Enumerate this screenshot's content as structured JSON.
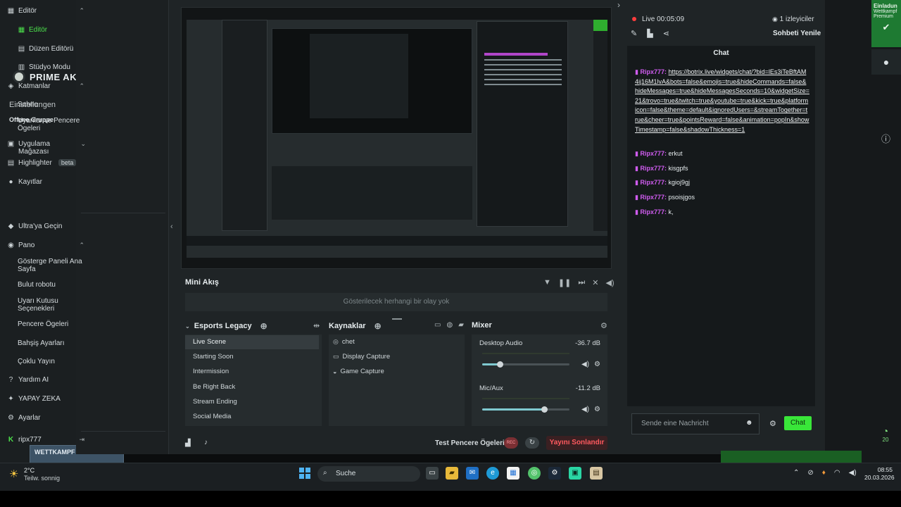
{
  "background": {
    "brand": "PRIME AKTI",
    "einstellungen": "Einstellungen",
    "offene_gruppe": "Offene Gruppe",
    "thumb_label": "WETTKAMPF"
  },
  "sidebar": {
    "editor_group": "Editör",
    "editor": "Editör",
    "layout_editor": "Düzen Editörü",
    "studio_mode": "Stüdyo Modu",
    "layers": "Katmanlar",
    "scene": "Sahne",
    "alerts": "Uyarılar ve Pencere Ögeleri",
    "app_store": "Uygulama Mağazası",
    "highlighter": "Highlighter",
    "beta": "beta",
    "recordings": "Kayıtlar",
    "ultra": "Ultra'ya Geçin",
    "panel": "Pano",
    "dashboard": "Gösterge Paneli Ana Sayfa",
    "cloudbot": "Bulut robotu",
    "alertbox": "Uyarı Kutusu Seçenekleri",
    "widgets": "Pencere Ögeleri",
    "tip_settings": "Bahşiş Ayarları",
    "multistream": "Çoklu Yayın",
    "help_ai": "Yardım AI",
    "ai": "YAPAY ZEKA",
    "settings": "Ayarlar",
    "user": "ripx777"
  },
  "mini_feed": {
    "title": "Mini Akış",
    "empty": "Gösterilecek herhangi bir olay yok"
  },
  "scenes": {
    "title": "Esports Legacy",
    "items": [
      "Live Scene",
      "Starting Soon",
      "Intermission",
      "Be Right Back",
      "Stream Ending",
      "Social Media"
    ],
    "selected": 0
  },
  "sources": {
    "title": "Kaynaklar",
    "items": [
      "chet",
      "Display Capture",
      "Game Capture"
    ]
  },
  "mixer": {
    "title": "Mixer",
    "channels": [
      {
        "name": "Desktop Audio",
        "db": "-36.7 dB",
        "level": 0.2
      },
      {
        "name": "Mic/Aux",
        "db": "-11.2 dB",
        "level": 0.71
      }
    ]
  },
  "bottom": {
    "test_widgets": "Test Pencere Ögeleri",
    "rec": "REC",
    "stop": "Yayını Sonlandır"
  },
  "chat": {
    "live_label": "Live 00:05:09",
    "viewers": "1 izleyiciler",
    "refresh": "Sohbeti Yenile",
    "title": "Chat",
    "messages": [
      {
        "user": "Ripx777:",
        "text": "https://botrix.live/widgets/chat/?bid=lEs3iTeBftAM4ij16M1lvA&bots=false&emojis=true&hideCommands=false&hideMessages=true&hideMessagesSeconds=10&widgetSize=21&trovo=true&twitch=true&youtube=true&kick=true&platformicon=false&theme=default&ignoredUsers=&streamTogether=true&cheer=true&pointsReward=false&animation=popIn&showTimestamp=false&shadowThickness=1",
        "link": true
      },
      {
        "user": "Ripx777:",
        "text": "erkut"
      },
      {
        "user": "Ripx777:",
        "text": "kisgpfs"
      },
      {
        "user": "Ripx777:",
        "text": "kgioj9gj"
      },
      {
        "user": "Ripx777:",
        "text": "psoisjgos"
      },
      {
        "user": "Ripx777:",
        "text": "k,"
      }
    ],
    "input_placeholder": "Sende eine Nachricht",
    "send": "Chat"
  },
  "right_strip": {
    "invite_title": "Einladun",
    "invite_sub": "Wettkampf",
    "invite_sub2": "Premium",
    "timer": "20"
  },
  "taskbar": {
    "temp": "2°C",
    "weather": "Teilw. sonnig",
    "search": "Suche",
    "time": "08:55",
    "date": "20.03.2026"
  },
  "colors": {
    "accent_green": "#39e639",
    "chat_user": "#d05cf0",
    "stop_red": "#ff5a5f"
  }
}
